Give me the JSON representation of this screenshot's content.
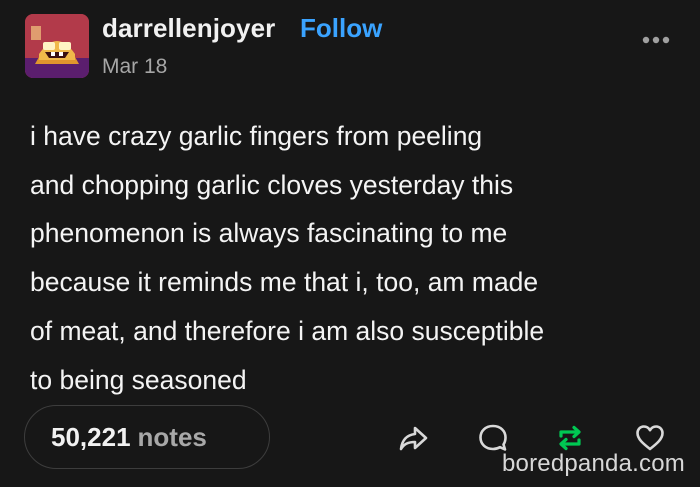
{
  "post": {
    "username": "darrellenjoyer",
    "follow_label": "Follow",
    "date": "Mar 18",
    "body": "i have crazy garlic fingers from peeling\nand chopping garlic cloves yesterday this\nphenomenon is always fascinating to me\nbecause it reminds me that i, too, am made\nof meat, and therefore i am also susceptible\nto being seasoned"
  },
  "footer": {
    "notes_count": "50,221",
    "notes_label": "notes",
    "actions": [
      "share-icon",
      "reply-icon",
      "reblog-icon",
      "like-icon"
    ]
  },
  "watermark": "boredpanda.com",
  "colors": {
    "background": "#171717",
    "follow": "#3aa3ff",
    "reblog": "#00c853",
    "muted": "#a6a6a6"
  }
}
